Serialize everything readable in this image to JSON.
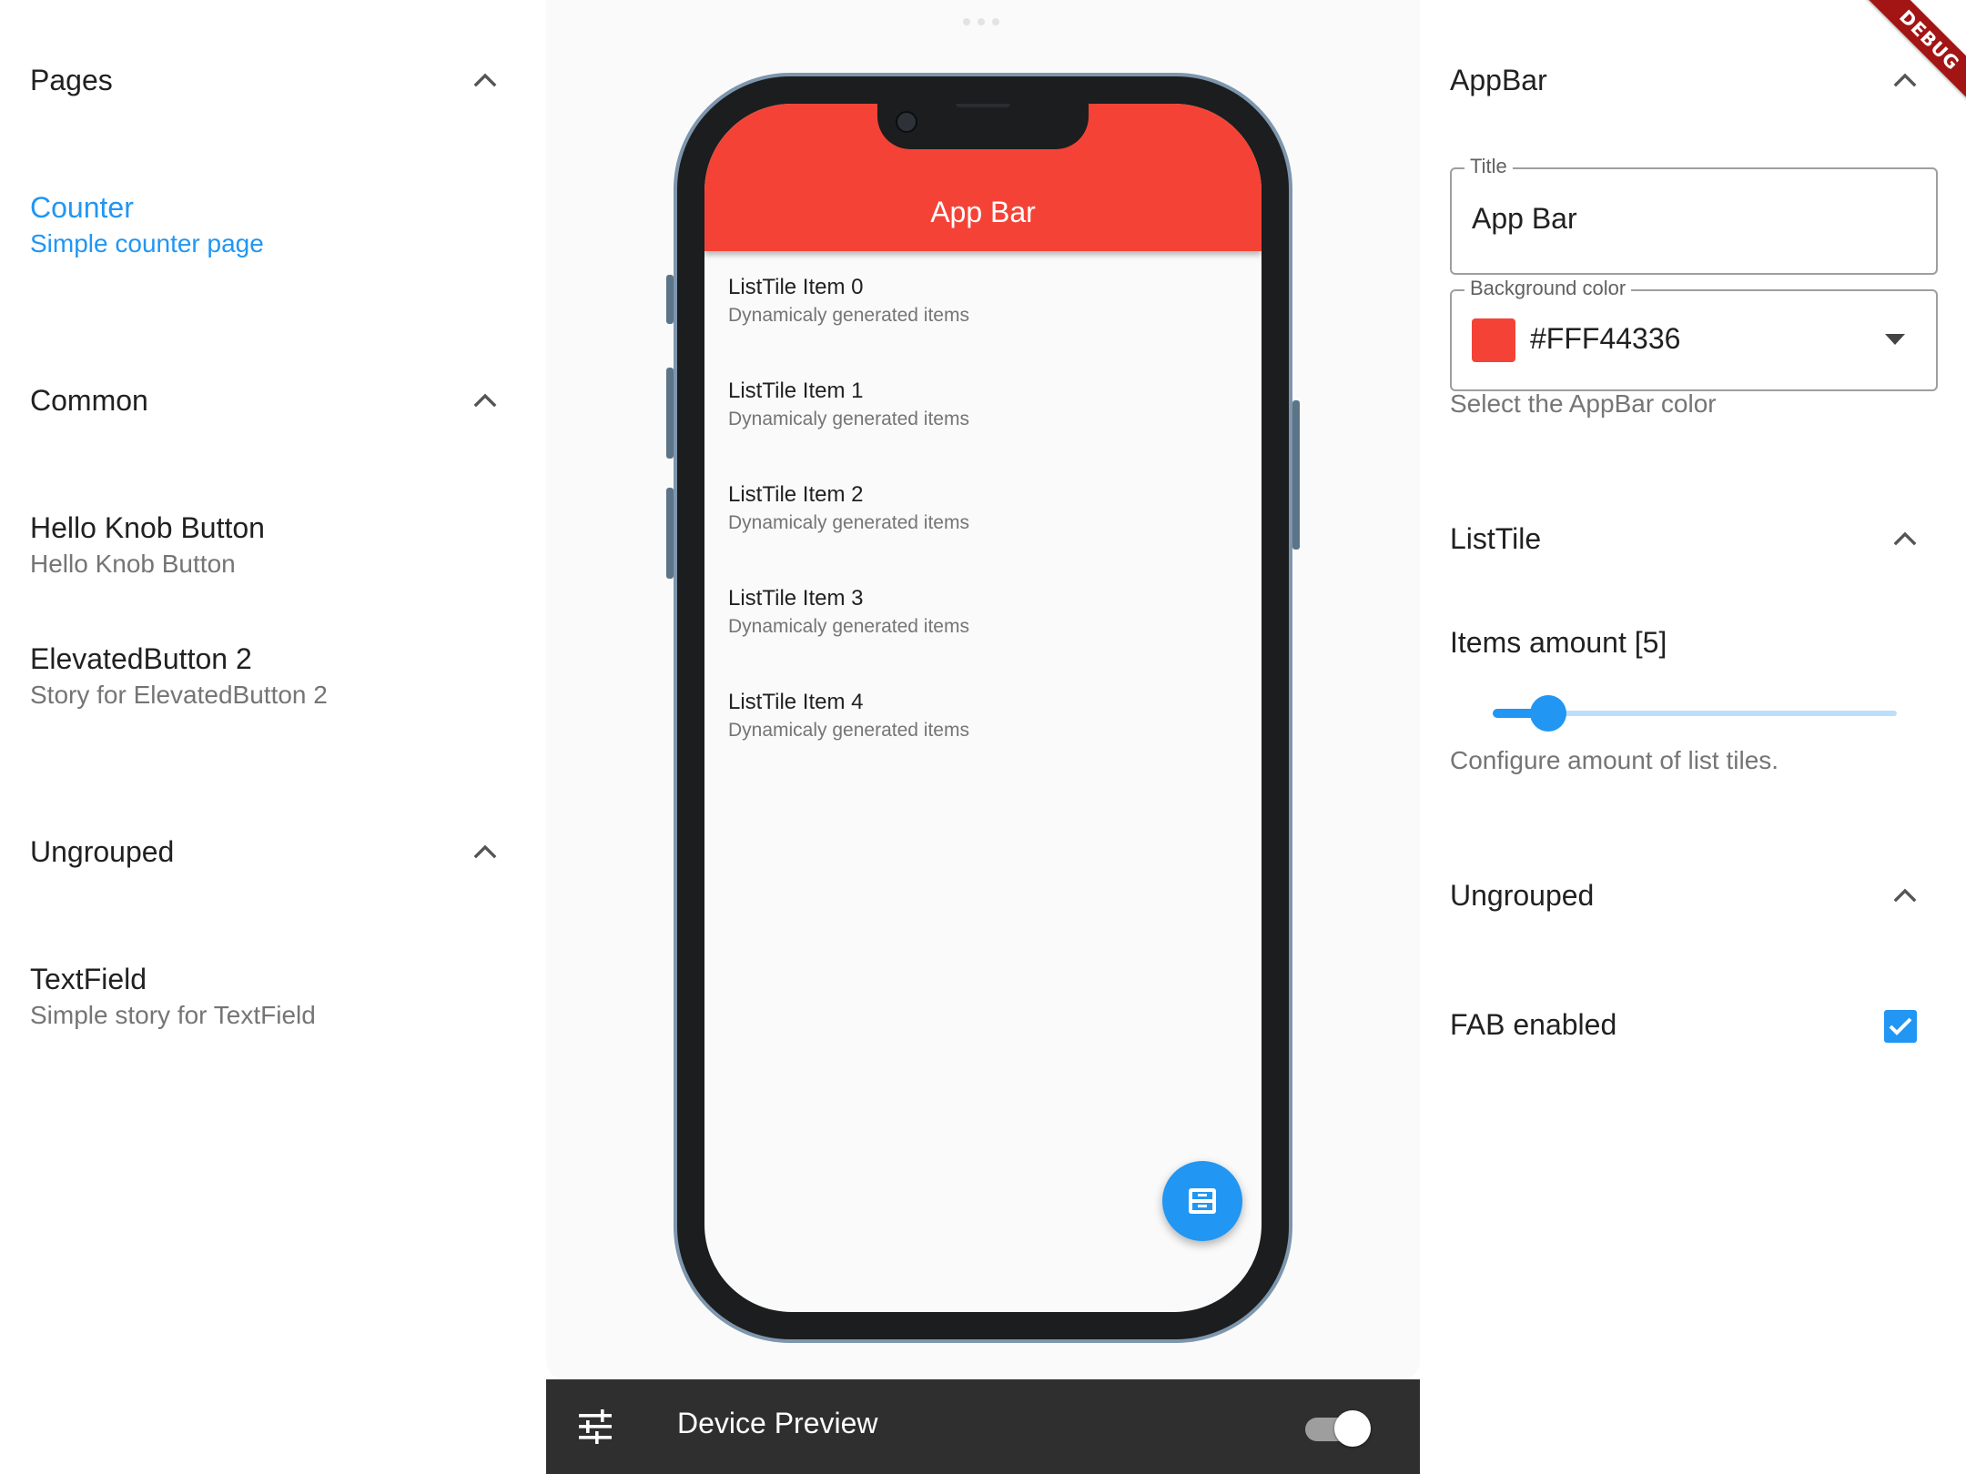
{
  "left_panel": {
    "sections": [
      {
        "title": "Pages",
        "items": [
          {
            "title": "Counter",
            "subtitle": "Simple counter page",
            "active": true
          }
        ]
      },
      {
        "title": "Common",
        "items": [
          {
            "title": "Hello Knob Button",
            "subtitle": "Hello Knob Button"
          },
          {
            "title": "ElevatedButton 2",
            "subtitle": "Story for ElevatedButton 2"
          }
        ]
      },
      {
        "title": "Ungrouped",
        "items": [
          {
            "title": "TextField",
            "subtitle": "Simple story for TextField"
          }
        ]
      }
    ]
  },
  "preview": {
    "app_bar_title": "App Bar",
    "app_bar_color": "#F44336",
    "list_tiles": [
      {
        "title": "ListTile Item 0",
        "subtitle": "Dynamicaly generated items"
      },
      {
        "title": "ListTile Item 1",
        "subtitle": "Dynamicaly generated items"
      },
      {
        "title": "ListTile Item 2",
        "subtitle": "Dynamicaly generated items"
      },
      {
        "title": "ListTile Item 3",
        "subtitle": "Dynamicaly generated items"
      },
      {
        "title": "ListTile Item 4",
        "subtitle": "Dynamicaly generated items"
      }
    ],
    "fab_icon": "inbox-icon"
  },
  "bottom_bar": {
    "title": "Device Preview",
    "toggle_on": true,
    "settings_icon": "tune-icon"
  },
  "right_panel": {
    "appbar_section": {
      "title": "AppBar",
      "title_field": {
        "label": "Title",
        "value": "App Bar"
      },
      "color_field": {
        "label": "Background color",
        "value": "#FFF44336",
        "swatch": "#F44336",
        "helper": "Select the AppBar color"
      }
    },
    "listtile_section": {
      "title": "ListTile",
      "items_label": "Items amount [5]",
      "slider_value": 5,
      "slider_min": 1,
      "slider_max": 30,
      "helper": "Configure amount of list tiles."
    },
    "ungrouped_section": {
      "title": "Ungrouped",
      "fab_label": "FAB enabled",
      "fab_checked": true
    }
  },
  "debug_banner": "DEBUG",
  "colors": {
    "accent": "#2196F3",
    "bottom_bar": "#2f2f2f",
    "app_bar": "#F44336"
  }
}
